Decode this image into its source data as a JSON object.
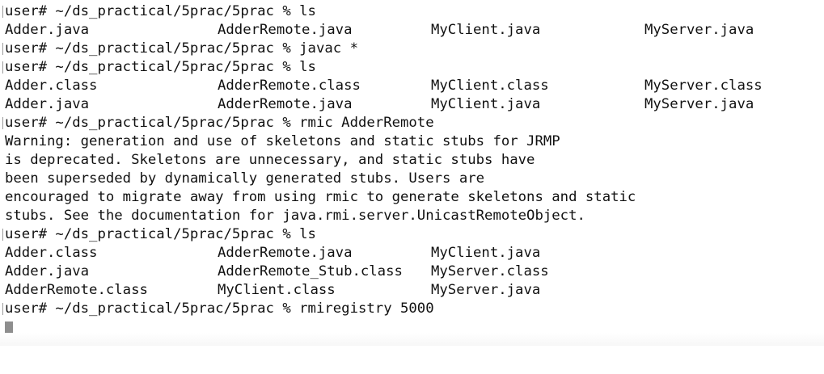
{
  "terminal": {
    "lines": [
      {
        "prompt": true,
        "text": "user# ~/ds_practical/5prac/5prac % ls"
      },
      {
        "cells": [
          "Adder.java",
          "AdderRemote.java",
          "MyClient.java",
          "MyServer.java"
        ]
      },
      {
        "prompt": true,
        "text": "user# ~/ds_practical/5prac/5prac % javac *"
      },
      {
        "prompt": true,
        "text": "user# ~/ds_practical/5prac/5prac % ls"
      },
      {
        "cells": [
          "Adder.class",
          "AdderRemote.class",
          "MyClient.class",
          "MyServer.class"
        ]
      },
      {
        "cells": [
          "Adder.java",
          "AdderRemote.java",
          "MyClient.java",
          "MyServer.java"
        ]
      },
      {
        "prompt": true,
        "text": "user# ~/ds_practical/5prac/5prac % rmic AdderRemote"
      },
      {
        "text": "Warning: generation and use of skeletons and static stubs for JRMP"
      },
      {
        "text": "is deprecated. Skeletons are unnecessary, and static stubs have"
      },
      {
        "text": "been superseded by dynamically generated stubs. Users are"
      },
      {
        "text": "encouraged to migrate away from using rmic to generate skeletons and static"
      },
      {
        "text": "stubs. See the documentation for java.rmi.server.UnicastRemoteObject."
      },
      {
        "prompt": true,
        "text": "user# ~/ds_practical/5prac/5prac % ls"
      },
      {
        "cells": [
          "Adder.class",
          "AdderRemote.java",
          "MyClient.java",
          ""
        ]
      },
      {
        "cells": [
          "Adder.java",
          "AdderRemote_Stub.class",
          "MyServer.class",
          ""
        ]
      },
      {
        "cells": [
          "AdderRemote.class",
          "MyClient.class",
          "MyServer.java",
          ""
        ]
      },
      {
        "prompt": true,
        "text": "user# ~/ds_practical/5prac/5prac % rmiregistry 5000"
      }
    ]
  }
}
